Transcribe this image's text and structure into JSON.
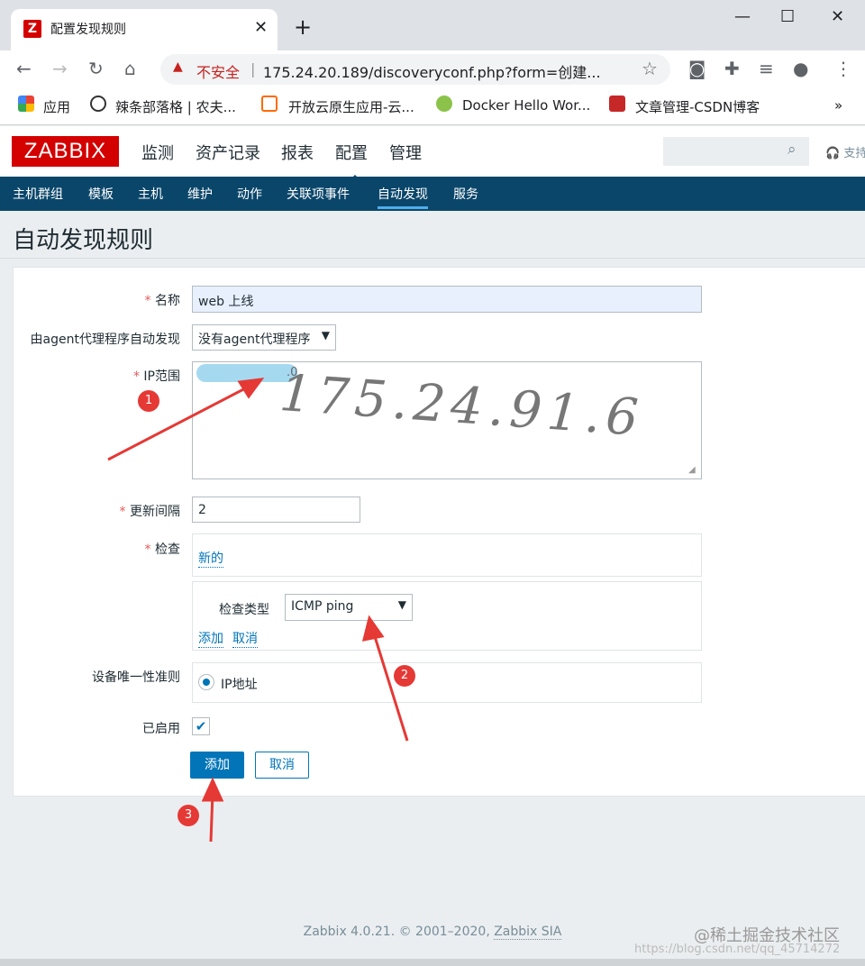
{
  "browser": {
    "tab_title": "配置发现规则",
    "tab_favicon": "Z",
    "address_warning": "不安全",
    "address_separator": "|",
    "url": "175.24.20.189/discoveryconf.php?form=创建...",
    "bookmarks": [
      "应用",
      "辣条部落格 | 农夫...",
      "开放云原生应用-云...",
      "Docker Hello Wor...",
      "文章管理-CSDN博客"
    ],
    "bookmarks_more": "»"
  },
  "zabbix": {
    "logo": "ZABBIX",
    "main_menu": [
      "监测",
      "资产记录",
      "报表",
      "配置",
      "管理"
    ],
    "active_menu": "配置",
    "support": "支持",
    "sub_menu": [
      "主机群组",
      "模板",
      "主机",
      "维护",
      "动作",
      "关联项事件",
      "自动发现",
      "服务"
    ],
    "active_sub": "自动发现",
    "page_title": "自动发现规则"
  },
  "form": {
    "required_mark": "*",
    "name_label": "名称",
    "name_value": "web 上线",
    "proxy_label": "由agent代理程序自动发现",
    "proxy_value": "没有agent代理程序",
    "ip_label": "IP范围",
    "ip_value_fragment": ".0",
    "ip_handwritten": "175.24.91.6",
    "interval_label": "更新间隔",
    "interval_value": "2",
    "checks_label": "检查",
    "checks_new": "新的",
    "check_type_label": "检查类型",
    "check_type_value": "ICMP ping",
    "check_add": "添加",
    "check_cancel": "取消",
    "uniqueness_label": "设备唯一性准则",
    "uniqueness_option": "IP地址",
    "enabled_label": "已启用",
    "submit_label": "添加",
    "cancel_label": "取消"
  },
  "annotations": [
    "1",
    "2",
    "3"
  ],
  "footer": {
    "copyright_prefix": "Zabbix 4.0.21. © 2001–2020,",
    "copyright_link": "Zabbix SIA"
  },
  "watermark": {
    "site": "@稀土掘金技术社区",
    "url": "https://blog.csdn.net/qq_45714272"
  },
  "colors": {
    "zabbix_red": "#d40000",
    "subnav_bg": "#0a466a",
    "link_blue": "#0275b8",
    "annotation_red": "#e53935"
  }
}
